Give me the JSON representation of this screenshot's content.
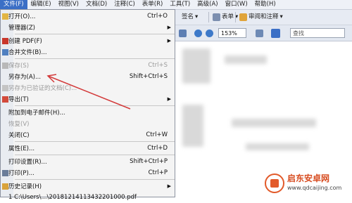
{
  "menubar": {
    "items": [
      "文件(F)",
      "编辑(E)",
      "视图(V)",
      "文档(D)",
      "注释(C)",
      "表单(R)",
      "工具(T)",
      "高级(A)",
      "窗口(W)",
      "帮助(H)"
    ]
  },
  "toolbar": {
    "sign_label": "签名",
    "form_label": "表单",
    "review_label": "审阅和注释",
    "zoom_value": "153%",
    "search_placeholder": "查找"
  },
  "file_menu": {
    "open": {
      "label": "打开(O)...",
      "shortcut": "Ctrl+O"
    },
    "organizer": {
      "label": "管理器(Z)"
    },
    "create_pdf": {
      "label": "创建 PDF(F)"
    },
    "combine": {
      "label": "合并文件(B)..."
    },
    "save": {
      "label": "保存(S)",
      "shortcut": "Ctrl+S"
    },
    "save_as": {
      "label": "另存为(A)...",
      "shortcut": "Shift+Ctrl+S"
    },
    "save_certified": {
      "label": "另存为已验证的文档(C)..."
    },
    "export": {
      "label": "导出(T)"
    },
    "attach_email": {
      "label": "附加到电子邮件(H)..."
    },
    "revert": {
      "label": "恢复(V)"
    },
    "close": {
      "label": "关闭(C)",
      "shortcut": "Ctrl+W"
    },
    "properties": {
      "label": "属性(E)...",
      "shortcut": "Ctrl+D"
    },
    "print_setup": {
      "label": "打印设置(R)...",
      "shortcut": "Shift+Ctrl+P"
    },
    "print": {
      "label": "打印(P)...",
      "shortcut": "Ctrl+P"
    },
    "history": {
      "label": "历史记录(H)"
    },
    "recent1": {
      "label": "1 C:\\Users\\...\\20181214113432201000.pdf"
    }
  },
  "watermark": {
    "name": "启东安卓网",
    "url": "www.qdcaijing.com"
  },
  "colors": {
    "accent": "#3b6fc6",
    "annotation_arrow": "#d33a3a"
  }
}
